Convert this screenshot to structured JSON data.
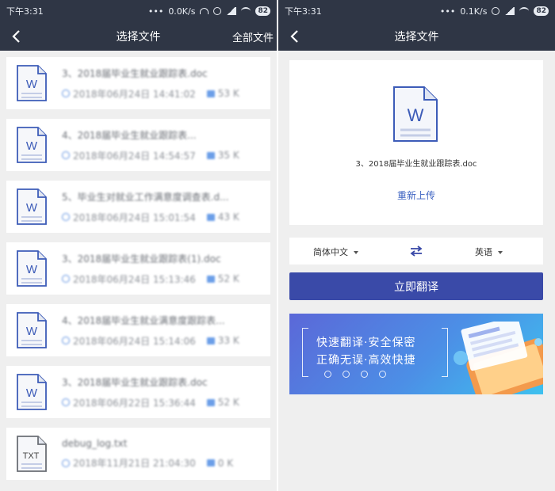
{
  "status_left": {
    "time": "下午3:31",
    "net_speed": "0.0K/s",
    "battery": "82"
  },
  "status_right": {
    "time": "下午3:31",
    "net_speed": "0.1K/s",
    "battery": "82"
  },
  "left_header": {
    "title": "选择文件",
    "action": "全部文件"
  },
  "right_header": {
    "title": "选择文件"
  },
  "files": [
    {
      "icon": "W",
      "name": "3、2018届毕业生就业跟踪表.doc",
      "date": "2018年06月24日 14:41:02",
      "size": "53 K"
    },
    {
      "icon": "W",
      "name": "4、2018届毕业生就业跟踪表...",
      "date": "2018年06月24日 14:54:57",
      "size": "35 K"
    },
    {
      "icon": "W",
      "name": "5、毕业生对就业工作满意度调查表.d...",
      "date": "2018年06月24日 15:01:54",
      "size": "43 K"
    },
    {
      "icon": "W",
      "name": "3、2018届毕业生就业跟踪表(1).doc",
      "date": "2018年06月24日 15:13:46",
      "size": "52 K"
    },
    {
      "icon": "W",
      "name": "4、2018届毕业生就业满意度跟踪表...",
      "date": "2018年06月24日 15:14:06",
      "size": "33 K"
    },
    {
      "icon": "W",
      "name": "3、2018届毕业生就业跟踪表.doc",
      "date": "2018年06月22日 15:36:44",
      "size": "52 K"
    },
    {
      "icon": "TXT",
      "name": "debug_log.txt",
      "date": "2018年11月21日 21:04:30",
      "size": "0 K"
    }
  ],
  "upload": {
    "file_name": "3、2018届毕业生就业跟踪表.doc",
    "reupload_label": "重新上传",
    "icon": "W"
  },
  "languages": {
    "source": "简体中文",
    "target": "英语"
  },
  "translate_button": "立即翻译",
  "banner": {
    "line1": "快速翻译·安全保密",
    "line2": "正确无误·高效快捷"
  },
  "colors": {
    "header_bg": "#2f3645",
    "accent": "#3a4aa8",
    "link": "#3d63c2"
  }
}
